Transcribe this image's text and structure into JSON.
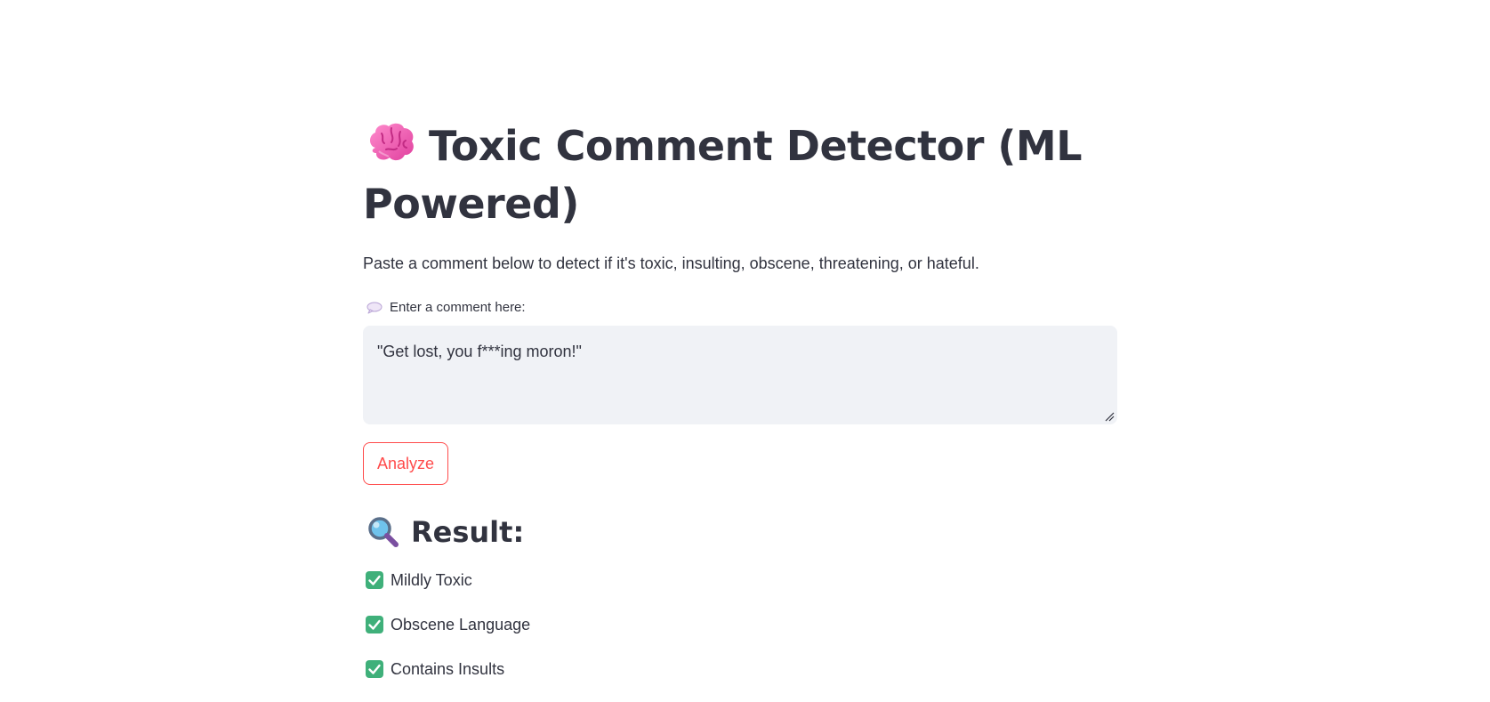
{
  "title": {
    "emoji_icon": "brain-icon",
    "text": "Toxic Comment Detector (ML Powered)"
  },
  "subtitle": "Paste a comment below to detect if it's toxic, insulting, obscene, threatening, or hateful.",
  "comment_field": {
    "label_icon": "speech-balloon-icon",
    "label": "Enter a comment here:",
    "value": "\"Get lost, you f***ing moron!\""
  },
  "analyze_button": {
    "label": "Analyze"
  },
  "result": {
    "heading_icon": "magnifying-glass-icon",
    "heading": "Result:",
    "items": [
      {
        "icon": "check-mark-icon",
        "label": "Mildly Toxic"
      },
      {
        "icon": "check-mark-icon",
        "label": "Obscene Language"
      },
      {
        "icon": "check-mark-icon",
        "label": "Contains Insults"
      }
    ]
  },
  "colors": {
    "text": "#31333f",
    "accent": "#ff4b4b",
    "input_bg": "#f0f2f6",
    "check_green": "#3fb07a"
  }
}
